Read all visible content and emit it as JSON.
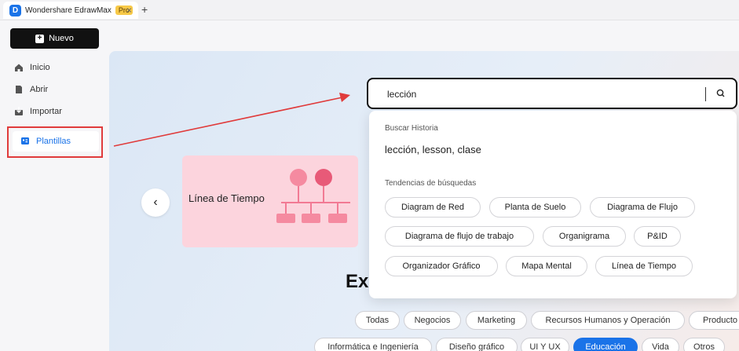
{
  "titlebar": {
    "app_name": "Wondershare EdrawMax",
    "pro_badge": "Pro",
    "close_glyph": "×",
    "add_tab_glyph": "+"
  },
  "sidebar": {
    "new_button": "Nuevo",
    "items": [
      {
        "label": "Inicio",
        "icon": "home-icon"
      },
      {
        "label": "Abrir",
        "icon": "file-icon"
      },
      {
        "label": "Importar",
        "icon": "import-icon"
      },
      {
        "label": "Plantillas",
        "icon": "templates-icon",
        "active": true
      }
    ]
  },
  "carousel": {
    "card_title": "Línea de Tiempo",
    "prev_glyph": "‹"
  },
  "explore": {
    "heading_fragment": "Ex"
  },
  "categories_row1": [
    "Todas",
    "Negocios",
    "Marketing",
    "Recursos Humanos y Operación",
    "Producto"
  ],
  "categories_row2": [
    "Informática e Ingeniería",
    "Diseño gráfico",
    "UI Y UX",
    "Educación",
    "Vida",
    "Otros"
  ],
  "active_category": "Educación",
  "search": {
    "value": "lección",
    "history_label": "Buscar Historia",
    "history_item": "lección, lesson, clase",
    "trends_label": "Tendencias de búsquedas",
    "trends": [
      [
        "Diagram de Red",
        "Planta de Suelo",
        "Diagrama de Flujo"
      ],
      [
        "Diagrama de flujo de trabajo",
        "Organigrama",
        "P&ID"
      ],
      [
        "Organizador Gráfico",
        "Mapa Mental",
        "Línea de Tiempo"
      ]
    ]
  },
  "colors": {
    "accent": "#1a73e8",
    "annotation_red": "#e03b3b",
    "card_pink": "#fcd4dd"
  }
}
